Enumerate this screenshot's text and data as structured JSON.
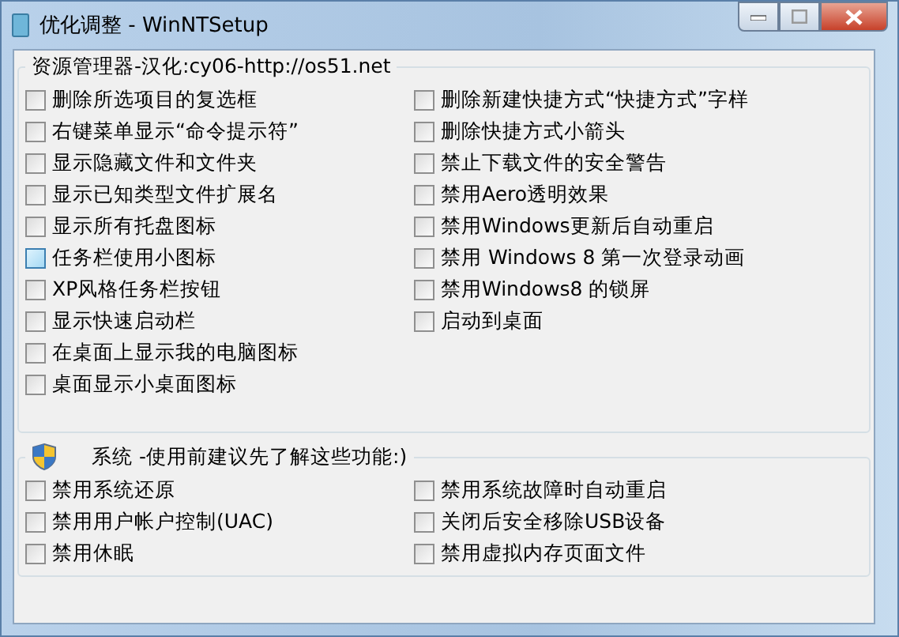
{
  "window": {
    "title": "优化调整 - WinNTSetup"
  },
  "groups": [
    {
      "kind": "explorer",
      "title": "资源管理器-汉化:cy06-http://os51.net",
      "columns": [
        [
          {
            "label": "删除所选项目的复选框",
            "checked": false,
            "hovered": false
          },
          {
            "label": "右键菜单显示“命令提示符”",
            "checked": false,
            "hovered": false
          },
          {
            "label": "显示隐藏文件和文件夹",
            "checked": false,
            "hovered": false
          },
          {
            "label": "显示已知类型文件扩展名",
            "checked": false,
            "hovered": false
          },
          {
            "label": "显示所有托盘图标",
            "checked": false,
            "hovered": false
          },
          {
            "label": "任务栏使用小图标",
            "checked": false,
            "hovered": true
          },
          {
            "label": "XP风格任务栏按钮",
            "checked": false,
            "hovered": false
          },
          {
            "label": "显示快速启动栏",
            "checked": false,
            "hovered": false
          },
          {
            "label": "在桌面上显示我的电脑图标",
            "checked": false,
            "hovered": false
          },
          {
            "label": "桌面显示小桌面图标",
            "checked": false,
            "hovered": false
          }
        ],
        [
          {
            "label": "删除新建快捷方式“快捷方式”字样",
            "checked": false,
            "hovered": false
          },
          {
            "label": "删除快捷方式小箭头",
            "checked": false,
            "hovered": false
          },
          {
            "label": "禁止下载文件的安全警告",
            "checked": false,
            "hovered": false
          },
          {
            "label": "禁用Aero透明效果",
            "checked": false,
            "hovered": false
          },
          {
            "label": "禁用Windows更新后自动重启",
            "checked": false,
            "hovered": false
          },
          {
            "label": "禁用 Windows 8 第一次登录动画",
            "checked": false,
            "hovered": false
          },
          {
            "label": "禁用Windows8 的锁屏",
            "checked": false,
            "hovered": false
          },
          {
            "label": "启动到桌面",
            "checked": false,
            "hovered": false
          }
        ]
      ]
    },
    {
      "title": "系统 -使用前建议先了解这些功能:)",
      "kind": "system",
      "columns": [
        [
          {
            "label": "禁用系统还原",
            "checked": false,
            "hovered": false
          },
          {
            "label": "禁用用户帐户控制(UAC)",
            "checked": false,
            "hovered": false
          },
          {
            "label": "禁用休眠",
            "checked": false,
            "hovered": false
          }
        ],
        [
          {
            "label": "禁用系统故障时自动重启",
            "checked": false,
            "hovered": false
          },
          {
            "label": "关闭后安全移除USB设备",
            "checked": false,
            "hovered": false
          },
          {
            "label": "禁用虚拟内存页面文件",
            "checked": false,
            "hovered": false
          }
        ]
      ]
    }
  ]
}
